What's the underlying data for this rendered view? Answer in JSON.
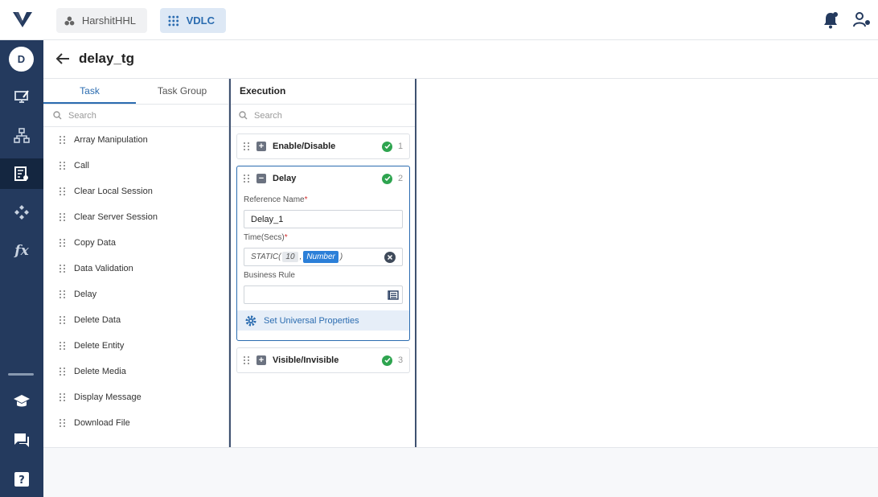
{
  "topbar": {
    "workspace_label": "HarshitHHL",
    "app_label": "VDLC",
    "logo_icon": "v-logo-icon",
    "icons": [
      "bell-icon",
      "users-gear-icon"
    ]
  },
  "sidebar": {
    "avatar_initial": "D",
    "items": [
      "desktop-pen-icon",
      "hierarchy-icon",
      "form-gear-icon",
      "diamond-nodes-icon",
      "function-icon"
    ],
    "active_index": 2,
    "bottom_items": [
      "graduation-cap-icon",
      "chat-icon",
      "help-icon"
    ]
  },
  "header": {
    "title": "delay_tg"
  },
  "tasks": {
    "tabs": [
      {
        "label": "Task"
      },
      {
        "label": "Task Group"
      }
    ],
    "active_tab": 0,
    "search_placeholder": "Search",
    "items": [
      {
        "label": "Array Manipulation"
      },
      {
        "label": "Call"
      },
      {
        "label": "Clear Local Session"
      },
      {
        "label": "Clear Server Session"
      },
      {
        "label": "Copy Data"
      },
      {
        "label": "Data Validation"
      },
      {
        "label": "Delay"
      },
      {
        "label": "Delete Data"
      },
      {
        "label": "Delete Entity"
      },
      {
        "label": "Delete Media"
      },
      {
        "label": "Display Message"
      },
      {
        "label": "Download File"
      }
    ]
  },
  "execution": {
    "title": "Execution",
    "search_placeholder": "Search",
    "steps": [
      {
        "name": "Enable/Disable",
        "number": "1"
      },
      {
        "name": "Delay",
        "number": "2"
      },
      {
        "name": "Visible/Invisible",
        "number": "3"
      }
    ],
    "delay_form": {
      "reference_label": "Reference Name",
      "reference_value": "Delay_1",
      "time_label": "Time(Secs)",
      "expr_prefix": "STATIC(",
      "expr_value": "10",
      "expr_sep": ",",
      "expr_type": "Number",
      "expr_suffix": ")",
      "rule_label": "Business Rule",
      "universal_label": "Set Universal Properties"
    }
  },
  "colors": {
    "accent": "#2b6cb0",
    "sidebar": "#243a5e",
    "success": "#2ea44f"
  }
}
